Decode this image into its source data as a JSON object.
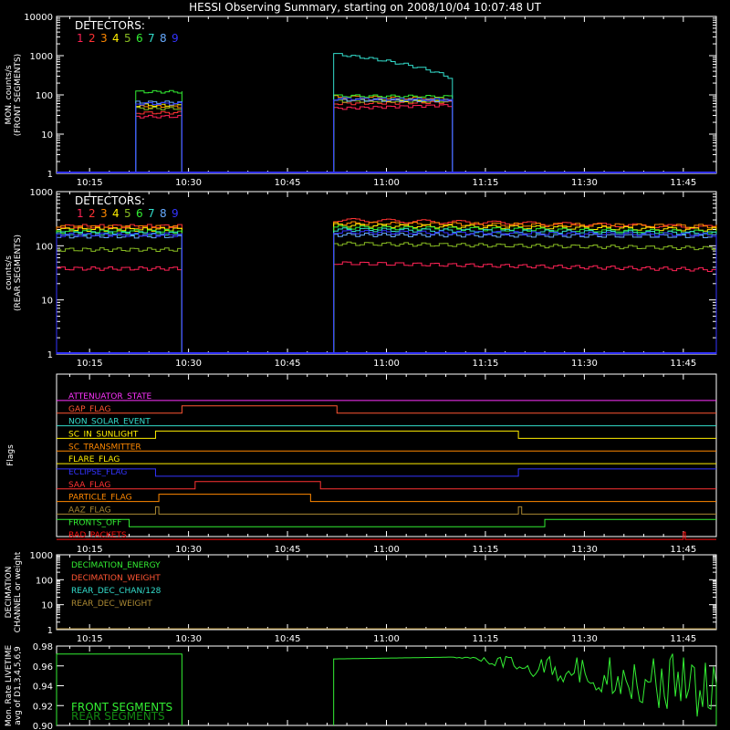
{
  "title": "HESSI Observing Summary, starting on 2008/10/04 10:07:48 UT",
  "det_colors": [
    "#ff2255",
    "#ff3333",
    "#ff8800",
    "#ffee00",
    "#88bb22",
    "#33ee33",
    "#33ddcc",
    "#66aaff",
    "#3333ff"
  ],
  "legend_title": "DETECTORS:",
  "legend_numbers": [
    "1",
    "2",
    "3",
    "4",
    "5",
    "6",
    "7",
    "8",
    "9"
  ],
  "x_ticks": [
    "10:15",
    "10:30",
    "10:45",
    "11:00",
    "11:15",
    "11:30",
    "11:45"
  ],
  "chart_data": [
    {
      "type": "line",
      "panel": "front",
      "ylabel": "MON. counts/s\n(FRONT SEGMENTS)",
      "yscale": "log",
      "ylim": [
        1,
        10000
      ],
      "yticks": [
        "1",
        "10",
        "100",
        "1000",
        "10000"
      ],
      "xlim_minutes": [
        10.0,
        110.0
      ],
      "series": [
        {
          "detector": "1",
          "color": "#ff2255",
          "segments": [
            {
              "x": [
                22,
                29
              ],
              "y": [
                28,
                28
              ]
            },
            {
              "x": [
                52,
                70
              ],
              "y": [
                45,
                55
              ]
            }
          ]
        },
        {
          "detector": "2",
          "color": "#ff3333",
          "segments": [
            {
              "x": [
                22,
                29
              ],
              "y": [
                35,
                35
              ]
            },
            {
              "x": [
                52,
                70
              ],
              "y": [
                60,
                65
              ]
            }
          ]
        },
        {
          "detector": "3",
          "color": "#ff8800",
          "segments": [
            {
              "x": [
                22,
                29
              ],
              "y": [
                50,
                50
              ]
            },
            {
              "x": [
                52,
                70
              ],
              "y": [
                90,
                80
              ]
            }
          ]
        },
        {
          "detector": "4",
          "color": "#ffee00",
          "segments": [
            {
              "x": [
                22,
                29
              ],
              "y": [
                55,
                55
              ]
            },
            {
              "x": [
                52,
                70
              ],
              "y": [
                75,
                70
              ]
            }
          ]
        },
        {
          "detector": "5",
          "color": "#88bb22",
          "segments": [
            {
              "x": [
                22,
                29
              ],
              "y": [
                45,
                45
              ]
            },
            {
              "x": [
                52,
                70
              ],
              "y": [
                70,
                70
              ]
            }
          ]
        },
        {
          "detector": "6",
          "color": "#33ee33",
          "segments": [
            {
              "x": [
                22,
                29
              ],
              "y": [
                120,
                120
              ]
            },
            {
              "x": [
                52,
                70
              ],
              "y": [
                95,
                90
              ]
            }
          ]
        },
        {
          "detector": "7",
          "color": "#33ddcc",
          "segments": [
            {
              "x": [
                22,
                29
              ],
              "y": [
                60,
                60
              ]
            },
            {
              "x": [
                52,
                70
              ],
              "y": [
                1100,
                250
              ]
            }
          ]
        },
        {
          "detector": "8",
          "color": "#66aaff",
          "segments": [
            {
              "x": [
                22,
                29
              ],
              "y": [
                65,
                65
              ]
            },
            {
              "x": [
                52,
                70
              ],
              "y": [
                75,
                72
              ]
            }
          ]
        },
        {
          "detector": "9",
          "color": "#3333ff",
          "segments": [
            {
              "x": [
                22,
                29
              ],
              "y": [
                60,
                60
              ]
            },
            {
              "x": [
                52,
                70
              ],
              "y": [
                80,
                75
              ]
            }
          ]
        }
      ]
    },
    {
      "type": "line",
      "panel": "rear",
      "ylabel": "counts/s\n(REAR SEGMENTS)",
      "yscale": "log",
      "ylim": [
        1,
        1000
      ],
      "yticks": [
        "1",
        "10",
        "100",
        "1000"
      ],
      "xlim_minutes": [
        10.0,
        110.0
      ],
      "series": [
        {
          "detector": "1",
          "color": "#ff2255",
          "segments": [
            {
              "x": [
                10,
                29
              ],
              "y": [
                38,
                38
              ]
            },
            {
              "x": [
                52,
                110
              ],
              "y": [
                48,
                36
              ]
            }
          ]
        },
        {
          "detector": "2",
          "color": "#ff3333",
          "segments": [
            {
              "x": [
                10,
                29
              ],
              "y": [
                230,
                230
              ]
            },
            {
              "x": [
                52,
                110
              ],
              "y": [
                300,
                220
              ]
            }
          ]
        },
        {
          "detector": "3",
          "color": "#ff8800",
          "segments": [
            {
              "x": [
                10,
                29
              ],
              "y": [
                220,
                220
              ]
            },
            {
              "x": [
                52,
                110
              ],
              "y": [
                260,
                230
              ]
            }
          ]
        },
        {
          "detector": "4",
          "color": "#ffee00",
          "segments": [
            {
              "x": [
                10,
                29
              ],
              "y": [
                200,
                200
              ]
            },
            {
              "x": [
                52,
                110
              ],
              "y": [
                240,
                200
              ]
            }
          ]
        },
        {
          "detector": "5",
          "color": "#88bb22",
          "segments": [
            {
              "x": [
                10,
                29
              ],
              "y": [
                85,
                85
              ]
            },
            {
              "x": [
                52,
                110
              ],
              "y": [
                110,
                90
              ]
            }
          ]
        },
        {
          "detector": "6",
          "color": "#33ee33",
          "segments": [
            {
              "x": [
                10,
                29
              ],
              "y": [
                185,
                185
              ]
            },
            {
              "x": [
                52,
                110
              ],
              "y": [
                220,
                180
              ]
            }
          ]
        },
        {
          "detector": "7",
          "color": "#33ddcc",
          "segments": [
            {
              "x": [
                10,
                29
              ],
              "y": [
                170,
                170
              ]
            },
            {
              "x": [
                52,
                110
              ],
              "y": [
                200,
                170
              ]
            }
          ]
        },
        {
          "detector": "8",
          "color": "#66aaff",
          "segments": [
            {
              "x": [
                10,
                29
              ],
              "y": [
                150,
                150
              ]
            },
            {
              "x": [
                52,
                110
              ],
              "y": [
                160,
                150
              ]
            }
          ]
        },
        {
          "detector": "9",
          "color": "#3333ff",
          "segments": [
            {
              "x": [
                10,
                29
              ],
              "y": [
                160,
                160
              ]
            },
            {
              "x": [
                52,
                110
              ],
              "y": [
                180,
                160
              ]
            }
          ]
        }
      ]
    },
    {
      "type": "line",
      "panel": "flags",
      "ylabel": "Flags",
      "flags": [
        {
          "name": "ATTENUATOR_STATE",
          "color": "#ff33ff",
          "steps": [
            [
              10,
              0
            ],
            [
              110,
              0
            ]
          ]
        },
        {
          "name": "GAP_FLAG",
          "color": "#ff5533",
          "steps": [
            [
              10,
              0
            ],
            [
              29,
              1
            ],
            [
              52.5,
              0
            ],
            [
              110,
              0
            ]
          ]
        },
        {
          "name": "NON_SOLAR_EVENT",
          "color": "#33ddcc",
          "steps": [
            [
              10,
              0
            ],
            [
              110,
              0
            ]
          ]
        },
        {
          "name": "SC_IN_SUNLIGHT",
          "color": "#ffee00",
          "steps": [
            [
              10,
              0
            ],
            [
              25,
              1
            ],
            [
              80,
              0
            ],
            [
              110,
              0
            ]
          ]
        },
        {
          "name": "SC_TRANSMITTER",
          "color": "#ff8800",
          "steps": [
            [
              10,
              0
            ],
            [
              110,
              0
            ]
          ]
        },
        {
          "name": "FLARE_FLAG",
          "color": "#ffee00",
          "steps": [
            [
              10,
              0
            ],
            [
              110,
              0
            ]
          ]
        },
        {
          "name": "ECLIPSE_FLAG",
          "color": "#3333ff",
          "steps": [
            [
              10,
              1
            ],
            [
              25,
              0
            ],
            [
              80,
              1
            ],
            [
              110,
              1
            ]
          ]
        },
        {
          "name": "SAA_FLAG",
          "color": "#ff3333",
          "steps": [
            [
              10,
              0
            ],
            [
              31,
              1
            ],
            [
              50,
              0
            ],
            [
              110,
              0
            ]
          ]
        },
        {
          "name": "PARTICLE_FLAG",
          "color": "#ff8800",
          "steps": [
            [
              10,
              0
            ],
            [
              25.5,
              1
            ],
            [
              48.5,
              0
            ],
            [
              110,
              0
            ]
          ]
        },
        {
          "name": "AAZ_FLAG",
          "color": "#aa8833",
          "steps": [
            [
              10,
              0
            ],
            [
              25,
              1
            ],
            [
              25.5,
              0
            ],
            [
              80,
              1
            ],
            [
              80.5,
              0
            ],
            [
              110,
              0
            ]
          ]
        },
        {
          "name": "FRONTS_OFF",
          "color": "#33ee33",
          "steps": [
            [
              10,
              1
            ],
            [
              21,
              0
            ],
            [
              84,
              1
            ],
            [
              110,
              1
            ]
          ]
        },
        {
          "name": "BAD_PACKETS",
          "color": "#ff1111",
          "steps": [
            [
              10,
              0
            ],
            [
              105,
              1
            ],
            [
              105.3,
              0
            ],
            [
              110,
              0
            ]
          ]
        }
      ]
    },
    {
      "type": "line",
      "panel": "decimation",
      "ylabel": "DECIMATION\nCHANNEL or weight",
      "yscale": "log",
      "ylim": [
        1,
        1000
      ],
      "yticks": [
        "1",
        "10",
        "100",
        "1000"
      ],
      "series": [
        {
          "name": "DECIMATION_ENERGY",
          "color": "#33ee33"
        },
        {
          "name": "DECIMATION_WEIGHT",
          "color": "#ff5533"
        },
        {
          "name": "REAR_DEC_CHAN/128",
          "color": "#33ddcc"
        },
        {
          "name": "REAR_DEC_WEIGHT",
          "color": "#aa8833"
        }
      ]
    },
    {
      "type": "line",
      "panel": "livetime",
      "ylabel": "Mon. Rate LIVETIME\navg of D1,3,4,5,6,9",
      "ylim": [
        0.9,
        0.98
      ],
      "yticks": [
        "0.90",
        "0.92",
        "0.94",
        "0.96",
        "0.98"
      ],
      "series": [
        {
          "name": "FRONT SEGMENTS",
          "color": "#33ee33",
          "segments": [
            {
              "x": [
                10,
                29
              ],
              "y": [
                0.972,
                0.972
              ]
            },
            {
              "x": [
                52,
                110
              ],
              "y": [
                0.967,
                0.973
              ]
            }
          ]
        },
        {
          "name": "REAR SEGMENTS",
          "color": "#118811"
        }
      ]
    }
  ]
}
